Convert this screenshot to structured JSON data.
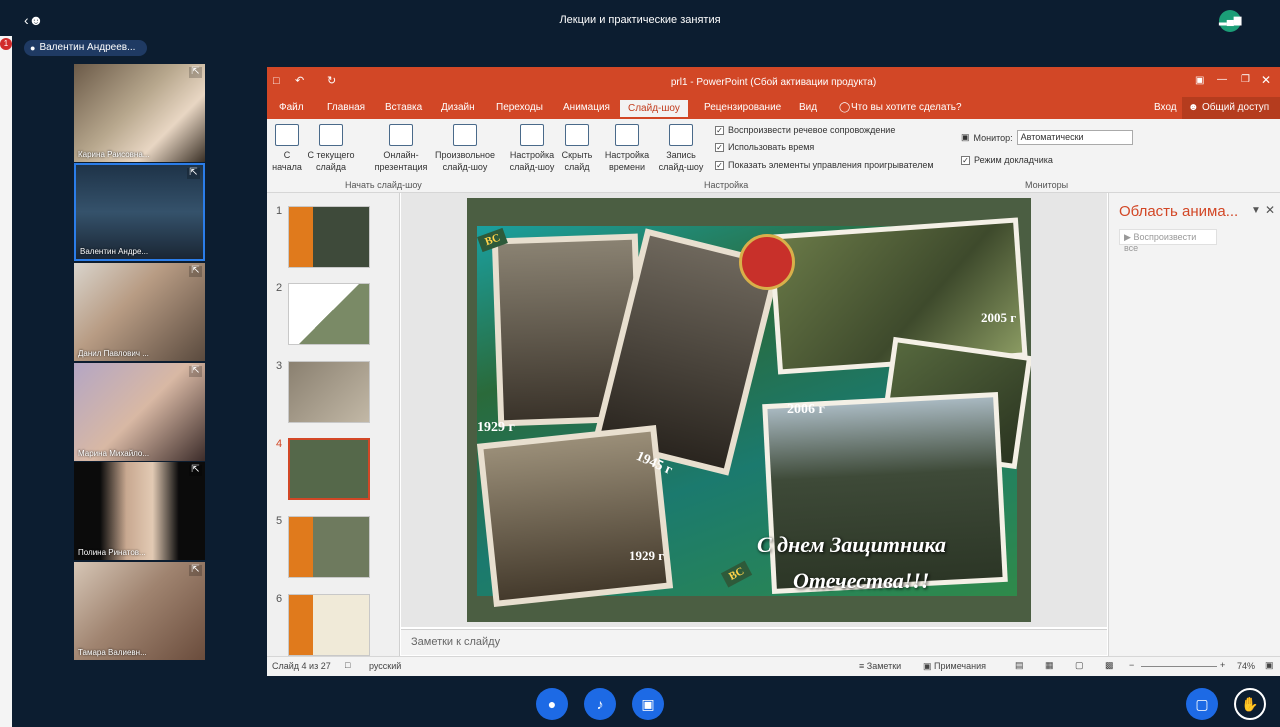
{
  "app": {
    "title": "Лекции и практические занятия",
    "badge_count": "1",
    "active_speaker": "Валентин Андреев..."
  },
  "participants": [
    {
      "name": "Карина Раисовна..."
    },
    {
      "name": "Валентин Андре..."
    },
    {
      "name": "Данил Павлович ..."
    },
    {
      "name": "Марина Михайло..."
    },
    {
      "name": "Полина Ринатов..."
    },
    {
      "name": "Тамара Валиевн..."
    }
  ],
  "ppt": {
    "window_title": "prl1 - PowerPoint (Сбой активации продукта)",
    "tabs": [
      "Файл",
      "Главная",
      "Вставка",
      "Дизайн",
      "Переходы",
      "Анимация",
      "Слайд-шоу",
      "Рецензирование",
      "Вид"
    ],
    "tell_me": "Что вы хотите сделать?",
    "signin": "Вход",
    "share": "Общий доступ",
    "ribbon": {
      "from_start": "С начала",
      "from_current": "С текущего слайда",
      "online": "Онлайн-презентация",
      "custom": "Произвольное слайд-шоу",
      "setup": "Настройка слайд-шоу",
      "hide": "Скрыть слайд",
      "rehearse": "Настройка времени",
      "record": "Запись слайд-шоу",
      "group_start": "Начать слайд-шоу",
      "group_setup": "Настройка",
      "group_monitors": "Мониторы",
      "chk_narration": "Воспроизвести речевое сопровождение",
      "chk_timings": "Использовать время",
      "chk_controls": "Показать элементы управления проигрывателем",
      "monitor_label": "Монитор:",
      "monitor_value": "Автоматически",
      "presenter_view": "Режим докладчика"
    },
    "slide_numbers": [
      "1",
      "2",
      "3",
      "4",
      "5",
      "6"
    ],
    "current_slide": 4,
    "slide_text": {
      "year1": "1929 г",
      "year2": "1945 г",
      "year3": "1929 г",
      "year4": "2006 г",
      "year5": "2005 г",
      "badge": "ВС",
      "caption_line1": "С днем Защитника",
      "caption_line2": "Отечества!!!"
    },
    "notes_placeholder": "Заметки к слайду",
    "anim_pane_title": "Область анима...",
    "play_all": "Воспроизвести все",
    "status": {
      "slide": "Слайд 4 из 27",
      "language": "русский",
      "notes": "Заметки",
      "comments": "Примечания",
      "zoom": "74%"
    }
  },
  "controls": [
    "microphone-button",
    "speaker-button",
    "camera-button",
    "screen-share-button",
    "raise-hand-button"
  ]
}
